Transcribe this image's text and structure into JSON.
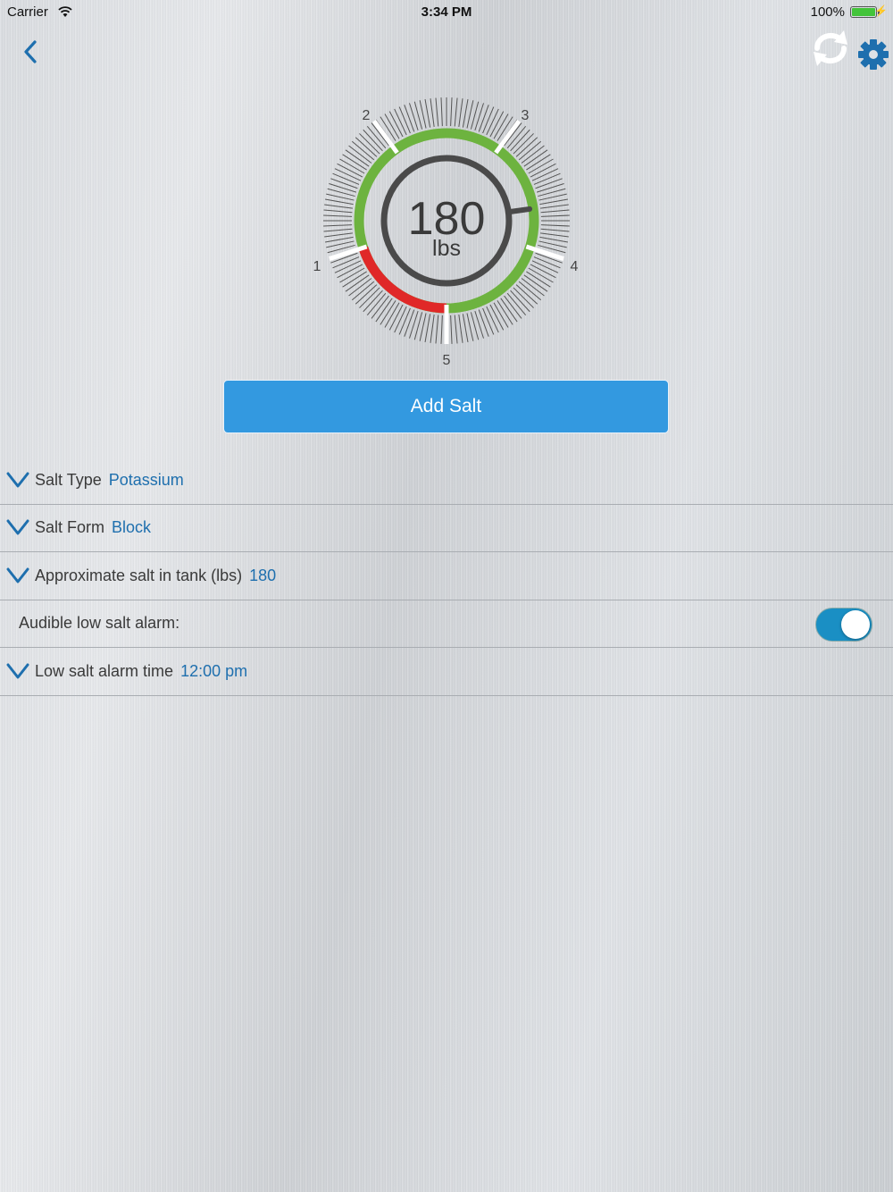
{
  "status_bar": {
    "carrier": "Carrier",
    "time": "3:34 PM",
    "battery": "100%"
  },
  "nav": {
    "back_icon": "chevron-left-icon",
    "refresh_icon": "refresh-icon",
    "settings_icon": "gear-icon",
    "accent": "#1e6fae"
  },
  "gauge": {
    "value": "180",
    "unit": "lbs",
    "ticks": [
      "1",
      "2",
      "3",
      "4",
      "5"
    ],
    "colors": {
      "ok": "#6db33f",
      "low": "#e02828",
      "ring": "#4a4a4a"
    }
  },
  "add_salt": {
    "label": "Add Salt",
    "color": "#3399e0"
  },
  "settings": {
    "salt_type": {
      "label": "Salt Type",
      "value": "Potassium"
    },
    "salt_form": {
      "label": "Salt Form",
      "value": "Block"
    },
    "salt_amount": {
      "label": "Approximate salt in tank (lbs)",
      "value": "180"
    },
    "audible_alarm": {
      "label": "Audible low salt alarm:",
      "enabled": true
    },
    "alarm_time": {
      "label": "Low salt alarm time",
      "value": "12:00 pm"
    }
  }
}
